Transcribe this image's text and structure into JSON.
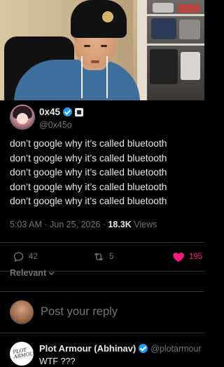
{
  "author": {
    "name": "0x45",
    "handle": "@0x45o"
  },
  "tweet": {
    "lines": [
      "don’t google why it’s called bluetooth",
      "don’t google why it’s called bluetooth",
      "don’t google why it’s called bluetooth",
      "don’t google why it’s called bluetooth",
      "don’t google why it’s called bluetooth"
    ],
    "time": "5:03 AM",
    "date": "Jun 25, 2026",
    "views": "18.3K",
    "views_label": "Views"
  },
  "actions": {
    "replies": "42",
    "reposts": "5",
    "likes": "195"
  },
  "sort": {
    "label": "Relevant"
  },
  "reply_box": {
    "placeholder": "Post your reply"
  },
  "next_reply": {
    "name": "Plot Armour (Abhinav)",
    "handle": "@plotarmour",
    "text": "WTF ???",
    "avatar_text": "PLOT ARMOUR"
  },
  "colors": {
    "verified": "#1d9bf0",
    "like": "#f91880",
    "muted": "#71767b",
    "text": "#e7e9ea",
    "background": "#000000"
  },
  "icons": [
    "verified-badge-icon",
    "affiliate-badge-icon",
    "reply-icon",
    "repost-icon",
    "like-heart-icon",
    "chevron-down-icon"
  ]
}
